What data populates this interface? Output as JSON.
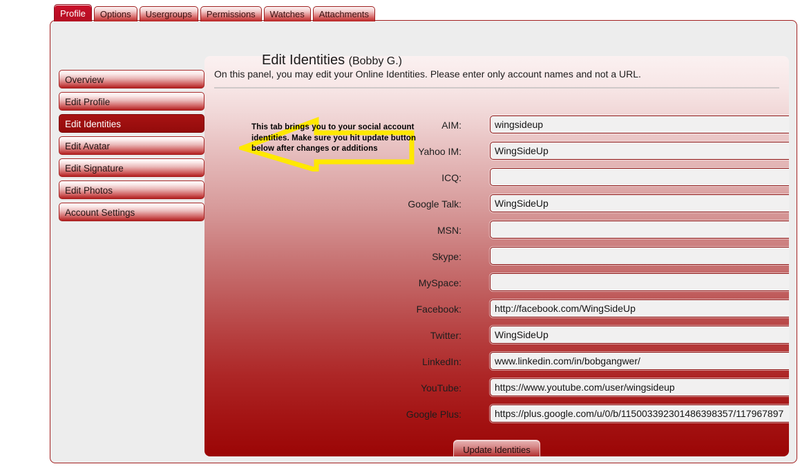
{
  "tabs": [
    {
      "label": "Profile",
      "active": true
    },
    {
      "label": "Options",
      "active": false
    },
    {
      "label": "Usergroups",
      "active": false
    },
    {
      "label": "Permissions",
      "active": false
    },
    {
      "label": "Watches",
      "active": false
    },
    {
      "label": "Attachments",
      "active": false
    }
  ],
  "sidebar": {
    "items": [
      {
        "label": "Overview",
        "active": false
      },
      {
        "label": "Edit Profile",
        "active": false
      },
      {
        "label": "Edit Identities",
        "active": true
      },
      {
        "label": "Edit Avatar",
        "active": false
      },
      {
        "label": "Edit Signature",
        "active": false
      },
      {
        "label": "Edit Photos",
        "active": false
      },
      {
        "label": "Account Settings",
        "active": false
      }
    ]
  },
  "page": {
    "title": "Edit Identities",
    "subtitle": "(Bobby G.)",
    "description": "On this panel, you may edit your Online Identities. Please enter only account names and not a URL."
  },
  "annotation": {
    "line1": "This tab brings you to your social account",
    "line2": "identities. Make sure you hit update button",
    "line3": "below after changes or additions",
    "color": "#ffe800",
    "direction": "left"
  },
  "form": {
    "fields": [
      {
        "label": "AIM:",
        "value": "wingsideup",
        "placeholder": ""
      },
      {
        "label": "Yahoo IM:",
        "value": "WingSideUp",
        "placeholder": ""
      },
      {
        "label": "ICQ:",
        "value": "",
        "placeholder": ""
      },
      {
        "label": "Google Talk:",
        "value": "WingSideUp",
        "placeholder": ""
      },
      {
        "label": "MSN:",
        "value": "",
        "placeholder": ""
      },
      {
        "label": "Skype:",
        "value": "",
        "placeholder": ""
      },
      {
        "label": "MySpace:",
        "value": "",
        "placeholder": ""
      },
      {
        "label": "Facebook:",
        "value": "http://facebook.com/WingSideUp",
        "placeholder": ""
      },
      {
        "label": "Twitter:",
        "value": "WingSideUp",
        "placeholder": ""
      },
      {
        "label": "LinkedIn:",
        "value": "www.linkedin.com/in/bobgangwer/",
        "placeholder": ""
      },
      {
        "label": "YouTube:",
        "value": "https://www.youtube.com/user/wingsideup",
        "placeholder": ""
      },
      {
        "label": "Google Plus:",
        "value": "https://plus.google.com/u/0/b/115003392301486398357/117967897",
        "placeholder": ""
      }
    ],
    "submit_label": "Update Identities"
  },
  "colors": {
    "accent": "#9b0505",
    "tab_active": "#c8102e",
    "annotation": "#ffe800",
    "field_bg": "#f1f0f0"
  }
}
